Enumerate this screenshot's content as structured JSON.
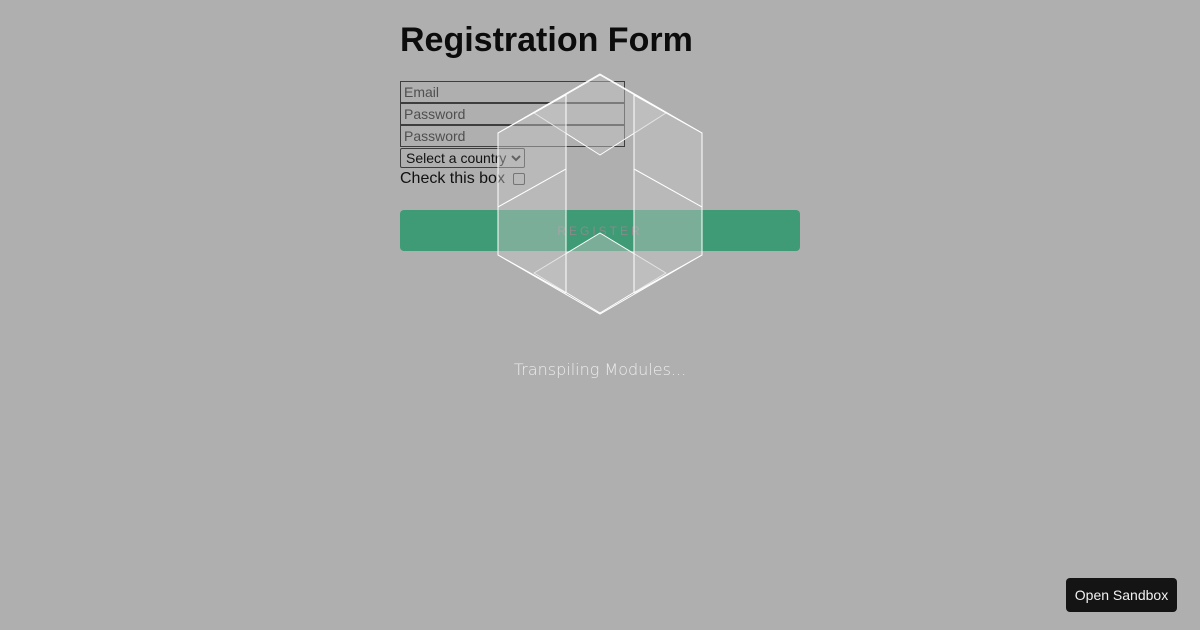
{
  "form": {
    "title": "Registration Form",
    "email_placeholder": "Email",
    "password_placeholder": "Password",
    "confirm_password_placeholder": "Password",
    "country_select": "Select a country",
    "checkbox_label": "Check this box",
    "checkbox_checked": false,
    "register_label": "REGISTER"
  },
  "loader": {
    "icon": "codesandbox-cube-icon",
    "status_text": "Transpiling Modules..."
  },
  "sandbox_button": {
    "label": "Open Sandbox"
  },
  "colors": {
    "background": "#afafaf",
    "register_button": "#3e9b76",
    "sandbox_button": "#141414"
  }
}
